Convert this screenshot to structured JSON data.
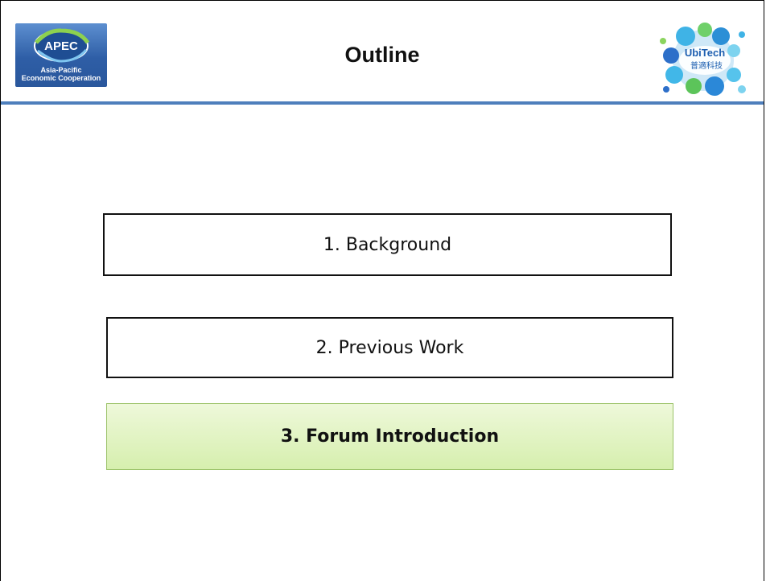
{
  "header": {
    "title": "Outline",
    "rule_color": "#4e7fbc",
    "left_logo": {
      "icon": "apec-logo",
      "wordmark": "APEC",
      "caption_line1": "Asia-Pacific",
      "caption_line2": "Economic Cooperation"
    },
    "right_logo": {
      "icon": "ubitech-logo",
      "wordmark": "UbiTech",
      "chinese": "普適科技"
    }
  },
  "outline": {
    "items": [
      {
        "label": "1. Background",
        "highlighted": false
      },
      {
        "label": "2. Previous Work",
        "highlighted": false
      },
      {
        "label": "3. Forum Introduction",
        "highlighted": true
      }
    ],
    "highlight_color": "#d6efae"
  }
}
